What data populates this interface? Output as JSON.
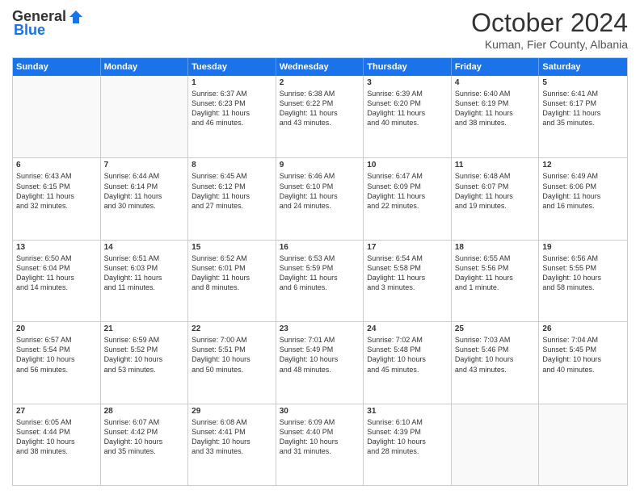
{
  "logo": {
    "general": "General",
    "blue": "Blue"
  },
  "title": "October 2024",
  "location": "Kuman, Fier County, Albania",
  "days": [
    "Sunday",
    "Monday",
    "Tuesday",
    "Wednesday",
    "Thursday",
    "Friday",
    "Saturday"
  ],
  "weeks": [
    [
      {
        "day": "",
        "lines": []
      },
      {
        "day": "",
        "lines": []
      },
      {
        "day": "1",
        "lines": [
          "Sunrise: 6:37 AM",
          "Sunset: 6:23 PM",
          "Daylight: 11 hours",
          "and 46 minutes."
        ]
      },
      {
        "day": "2",
        "lines": [
          "Sunrise: 6:38 AM",
          "Sunset: 6:22 PM",
          "Daylight: 11 hours",
          "and 43 minutes."
        ]
      },
      {
        "day": "3",
        "lines": [
          "Sunrise: 6:39 AM",
          "Sunset: 6:20 PM",
          "Daylight: 11 hours",
          "and 40 minutes."
        ]
      },
      {
        "day": "4",
        "lines": [
          "Sunrise: 6:40 AM",
          "Sunset: 6:19 PM",
          "Daylight: 11 hours",
          "and 38 minutes."
        ]
      },
      {
        "day": "5",
        "lines": [
          "Sunrise: 6:41 AM",
          "Sunset: 6:17 PM",
          "Daylight: 11 hours",
          "and 35 minutes."
        ]
      }
    ],
    [
      {
        "day": "6",
        "lines": [
          "Sunrise: 6:43 AM",
          "Sunset: 6:15 PM",
          "Daylight: 11 hours",
          "and 32 minutes."
        ]
      },
      {
        "day": "7",
        "lines": [
          "Sunrise: 6:44 AM",
          "Sunset: 6:14 PM",
          "Daylight: 11 hours",
          "and 30 minutes."
        ]
      },
      {
        "day": "8",
        "lines": [
          "Sunrise: 6:45 AM",
          "Sunset: 6:12 PM",
          "Daylight: 11 hours",
          "and 27 minutes."
        ]
      },
      {
        "day": "9",
        "lines": [
          "Sunrise: 6:46 AM",
          "Sunset: 6:10 PM",
          "Daylight: 11 hours",
          "and 24 minutes."
        ]
      },
      {
        "day": "10",
        "lines": [
          "Sunrise: 6:47 AM",
          "Sunset: 6:09 PM",
          "Daylight: 11 hours",
          "and 22 minutes."
        ]
      },
      {
        "day": "11",
        "lines": [
          "Sunrise: 6:48 AM",
          "Sunset: 6:07 PM",
          "Daylight: 11 hours",
          "and 19 minutes."
        ]
      },
      {
        "day": "12",
        "lines": [
          "Sunrise: 6:49 AM",
          "Sunset: 6:06 PM",
          "Daylight: 11 hours",
          "and 16 minutes."
        ]
      }
    ],
    [
      {
        "day": "13",
        "lines": [
          "Sunrise: 6:50 AM",
          "Sunset: 6:04 PM",
          "Daylight: 11 hours",
          "and 14 minutes."
        ]
      },
      {
        "day": "14",
        "lines": [
          "Sunrise: 6:51 AM",
          "Sunset: 6:03 PM",
          "Daylight: 11 hours",
          "and 11 minutes."
        ]
      },
      {
        "day": "15",
        "lines": [
          "Sunrise: 6:52 AM",
          "Sunset: 6:01 PM",
          "Daylight: 11 hours",
          "and 8 minutes."
        ]
      },
      {
        "day": "16",
        "lines": [
          "Sunrise: 6:53 AM",
          "Sunset: 5:59 PM",
          "Daylight: 11 hours",
          "and 6 minutes."
        ]
      },
      {
        "day": "17",
        "lines": [
          "Sunrise: 6:54 AM",
          "Sunset: 5:58 PM",
          "Daylight: 11 hours",
          "and 3 minutes."
        ]
      },
      {
        "day": "18",
        "lines": [
          "Sunrise: 6:55 AM",
          "Sunset: 5:56 PM",
          "Daylight: 11 hours",
          "and 1 minute."
        ]
      },
      {
        "day": "19",
        "lines": [
          "Sunrise: 6:56 AM",
          "Sunset: 5:55 PM",
          "Daylight: 10 hours",
          "and 58 minutes."
        ]
      }
    ],
    [
      {
        "day": "20",
        "lines": [
          "Sunrise: 6:57 AM",
          "Sunset: 5:54 PM",
          "Daylight: 10 hours",
          "and 56 minutes."
        ]
      },
      {
        "day": "21",
        "lines": [
          "Sunrise: 6:59 AM",
          "Sunset: 5:52 PM",
          "Daylight: 10 hours",
          "and 53 minutes."
        ]
      },
      {
        "day": "22",
        "lines": [
          "Sunrise: 7:00 AM",
          "Sunset: 5:51 PM",
          "Daylight: 10 hours",
          "and 50 minutes."
        ]
      },
      {
        "day": "23",
        "lines": [
          "Sunrise: 7:01 AM",
          "Sunset: 5:49 PM",
          "Daylight: 10 hours",
          "and 48 minutes."
        ]
      },
      {
        "day": "24",
        "lines": [
          "Sunrise: 7:02 AM",
          "Sunset: 5:48 PM",
          "Daylight: 10 hours",
          "and 45 minutes."
        ]
      },
      {
        "day": "25",
        "lines": [
          "Sunrise: 7:03 AM",
          "Sunset: 5:46 PM",
          "Daylight: 10 hours",
          "and 43 minutes."
        ]
      },
      {
        "day": "26",
        "lines": [
          "Sunrise: 7:04 AM",
          "Sunset: 5:45 PM",
          "Daylight: 10 hours",
          "and 40 minutes."
        ]
      }
    ],
    [
      {
        "day": "27",
        "lines": [
          "Sunrise: 6:05 AM",
          "Sunset: 4:44 PM",
          "Daylight: 10 hours",
          "and 38 minutes."
        ]
      },
      {
        "day": "28",
        "lines": [
          "Sunrise: 6:07 AM",
          "Sunset: 4:42 PM",
          "Daylight: 10 hours",
          "and 35 minutes."
        ]
      },
      {
        "day": "29",
        "lines": [
          "Sunrise: 6:08 AM",
          "Sunset: 4:41 PM",
          "Daylight: 10 hours",
          "and 33 minutes."
        ]
      },
      {
        "day": "30",
        "lines": [
          "Sunrise: 6:09 AM",
          "Sunset: 4:40 PM",
          "Daylight: 10 hours",
          "and 31 minutes."
        ]
      },
      {
        "day": "31",
        "lines": [
          "Sunrise: 6:10 AM",
          "Sunset: 4:39 PM",
          "Daylight: 10 hours",
          "and 28 minutes."
        ]
      },
      {
        "day": "",
        "lines": []
      },
      {
        "day": "",
        "lines": []
      }
    ]
  ]
}
